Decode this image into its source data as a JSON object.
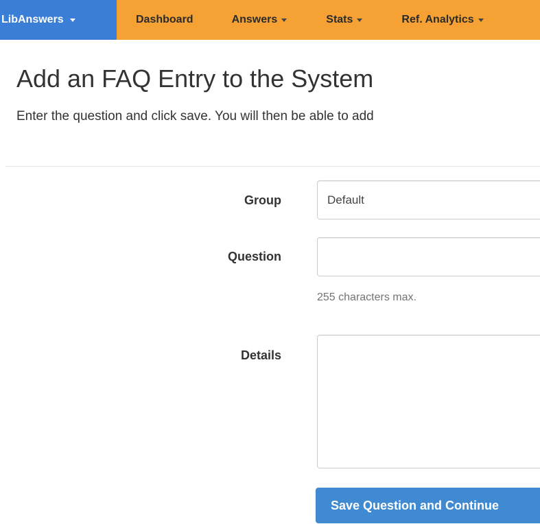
{
  "navbar": {
    "brand": "LibAnswers",
    "items": [
      {
        "label": "Dashboard",
        "has_caret": false
      },
      {
        "label": "Answers",
        "has_caret": true
      },
      {
        "label": "Stats",
        "has_caret": true
      },
      {
        "label": "Ref. Analytics",
        "has_caret": true
      }
    ],
    "colors": {
      "bar": "#f5a134",
      "brand": "#3a7ed8"
    }
  },
  "page": {
    "title": "Add an FAQ Entry to the System",
    "subtitle": "Enter the question and click save. You will then be able to add"
  },
  "form": {
    "group": {
      "label": "Group",
      "value": "Default"
    },
    "question": {
      "label": "Question",
      "value": "",
      "help": "255 characters max."
    },
    "details": {
      "label": "Details",
      "value": ""
    },
    "save_button": "Save Question and Continue",
    "button_color": "#3f8ad1"
  }
}
